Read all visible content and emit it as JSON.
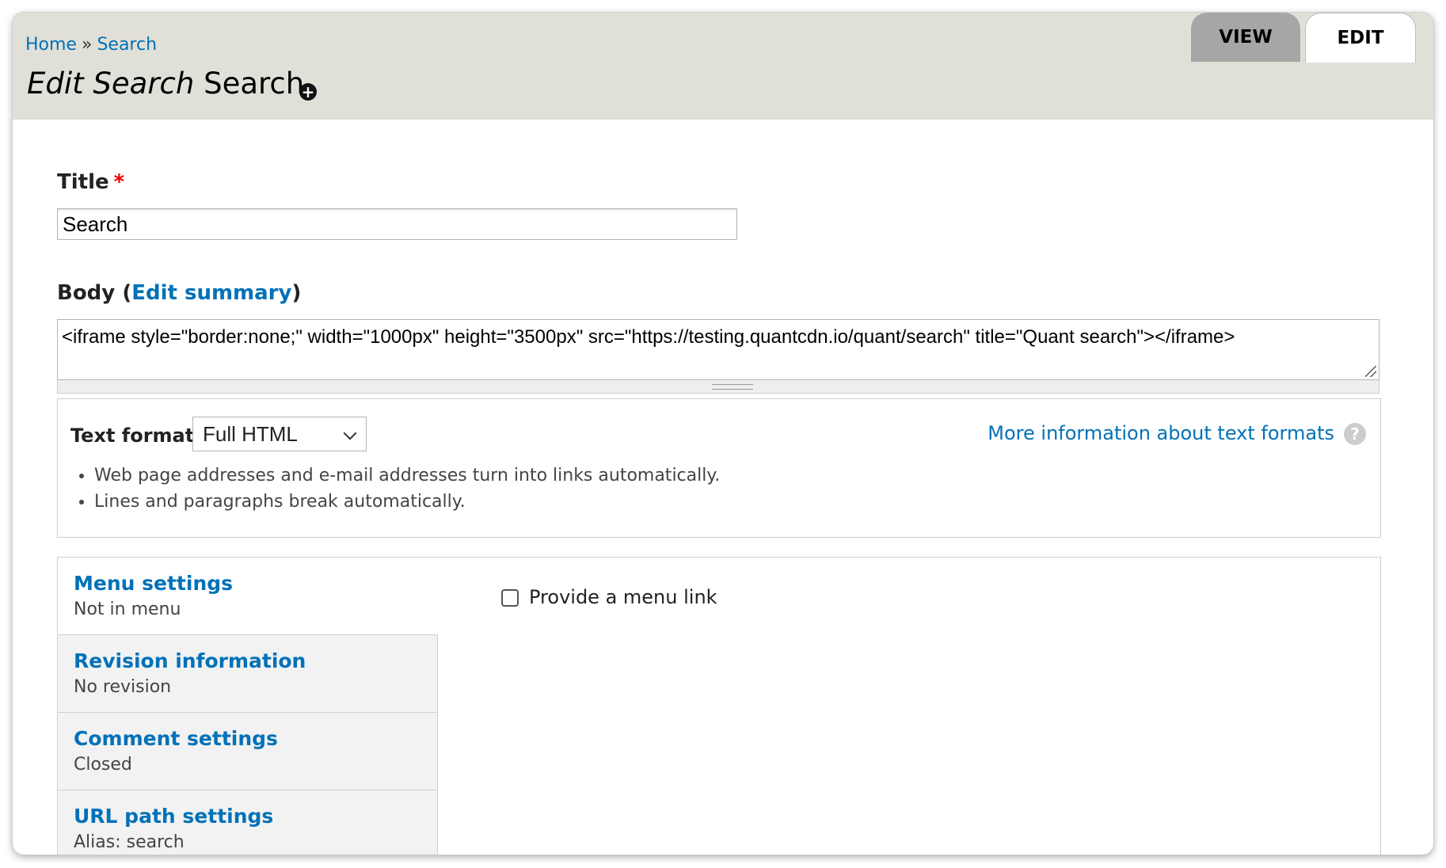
{
  "breadcrumb": {
    "home": "Home",
    "separator": "»",
    "current": "Search"
  },
  "page": {
    "title_em": "Edit Search",
    "title_rest": "Search",
    "add_icon": "+"
  },
  "tabs": {
    "view": "VIEW",
    "edit": "EDIT"
  },
  "form": {
    "title_label": "Title",
    "required_mark": "*",
    "title_value": "Search",
    "body_label": "Body",
    "body_paren_open": "(",
    "edit_summary": "Edit summary",
    "body_paren_close": ")",
    "body_value": "<iframe style=\"border:none;\" width=\"1000px\" height=\"3500px\" src=\"https://testing.quantcdn.io/quant/search\" title=\"Quant search\"></iframe>"
  },
  "text_format": {
    "label": "Text format",
    "selected": "Full HTML",
    "more_info": "More information about text formats",
    "help_icon": "?",
    "tips": [
      "Web page addresses and e-mail addresses turn into links automatically.",
      "Lines and paragraphs break automatically."
    ]
  },
  "settings": {
    "tabs": [
      {
        "title": "Menu settings",
        "summary": "Not in menu"
      },
      {
        "title": "Revision information",
        "summary": "No revision"
      },
      {
        "title": "Comment settings",
        "summary": "Closed"
      },
      {
        "title": "URL path settings",
        "summary": "Alias: search"
      }
    ],
    "menu_link_label": "Provide a menu link"
  },
  "colors": {
    "link": "#0071b8",
    "header_bg": "#e1e0d8",
    "required": "#ee0000"
  }
}
